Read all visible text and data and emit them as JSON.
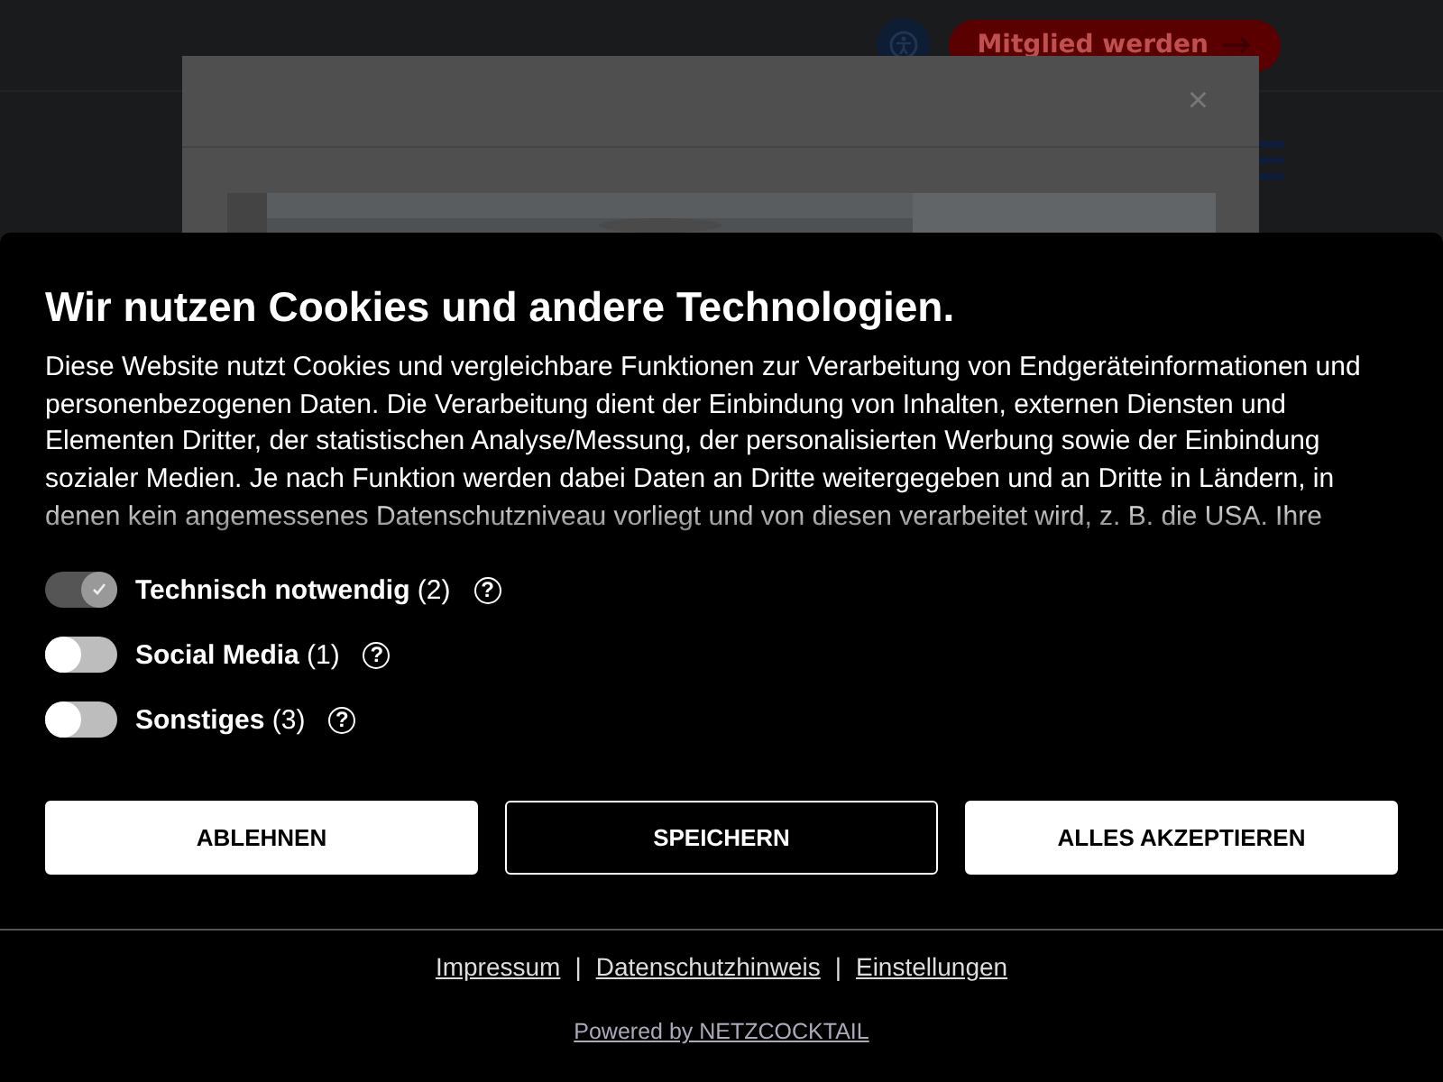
{
  "background_page": {
    "member_button": "Mitglied werden",
    "modal": {
      "close": "×"
    }
  },
  "cookie_banner": {
    "title": "Wir nutzen Cookies und andere Technologien.",
    "text": "Diese Website nutzt Cookies und vergleichbare Funktionen zur Verarbeitung von Endgeräteinformationen und personenbezogenen Daten. Die Verarbeitung dient der Einbindung von Inhalten, externen Diensten und Elementen Dritter, der statistischen Analyse/Messung, der personalisierten Werbung sowie der Einbindung sozialer Medien. Je nach Funktion werden dabei Daten an Dritte weitergegeben und an Dritte in Ländern, in denen kein angemessenes Datenschutzniveau vorliegt und von diesen verarbeitet wird, z. B. die USA. Ihre",
    "categories": [
      {
        "label": "Technisch notwendig",
        "count": "(2)",
        "checked": true,
        "disabled": true,
        "help": "?"
      },
      {
        "label": "Social Media",
        "count": "(1)",
        "checked": false,
        "disabled": false,
        "help": "?"
      },
      {
        "label": "Sonstiges",
        "count": "(3)",
        "checked": false,
        "disabled": false,
        "help": "?"
      }
    ],
    "buttons": [
      {
        "label": "ABLEHNEN",
        "kind": "filled"
      },
      {
        "label": "SPEICHERN",
        "kind": "outline"
      },
      {
        "label": "ALLES AKZEPTIEREN",
        "kind": "filled"
      }
    ],
    "footer_links": [
      "Impressum",
      "Datenschutzhinweis",
      "Einstellungen"
    ],
    "footer_separators": [
      "|",
      "|"
    ],
    "powered_by": "Powered by NETZCOCKTAIL"
  }
}
